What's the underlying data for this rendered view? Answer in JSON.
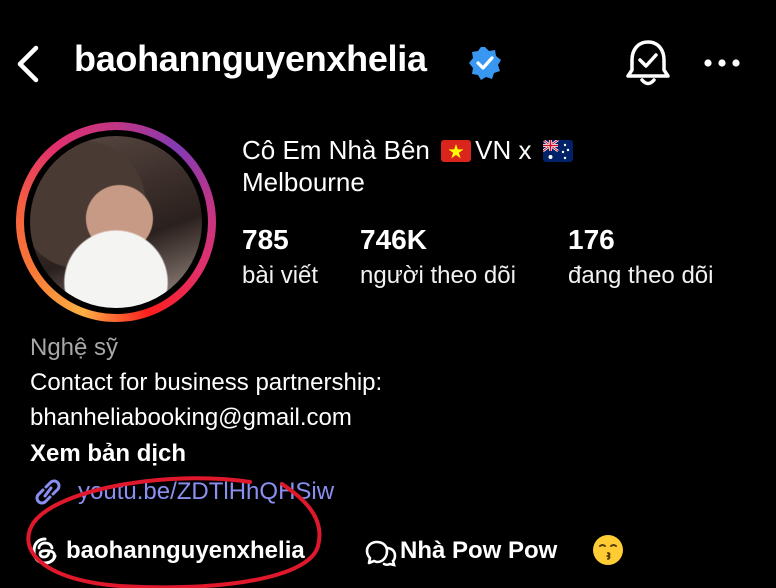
{
  "header": {
    "username": "baohannguyenxhelia",
    "back_icon": "chevron-left-icon",
    "notification_icon": "bell-icon",
    "more_icon": "more-icon"
  },
  "profile": {
    "name_part1": "Cô Em Nhà Bên",
    "name_part2": "VN x",
    "name_line2": "Melbourne",
    "posts_count": "785",
    "posts_label": "bài viết",
    "followers_count": "746K",
    "followers_label": "người theo dõi",
    "following_count": "176",
    "following_label": "đang theo dõi"
  },
  "bio": {
    "category": "Nghệ sỹ",
    "line1": "Contact for business partnership:",
    "line2": "bhanheliabooking@gmail.com",
    "translate": "Xem bản dịch",
    "link": "youtu.be/ZDTlHhQHSiw"
  },
  "threads": {
    "handle": "baohannguyenxhelia",
    "channel": "Nhà Pow Pow"
  },
  "colors": {
    "background": "#000000",
    "text": "#ffffff",
    "muted": "#a8a8a8",
    "link": "#8a8ff0",
    "verified": "#3897f0",
    "annotation": "#e0182b"
  }
}
